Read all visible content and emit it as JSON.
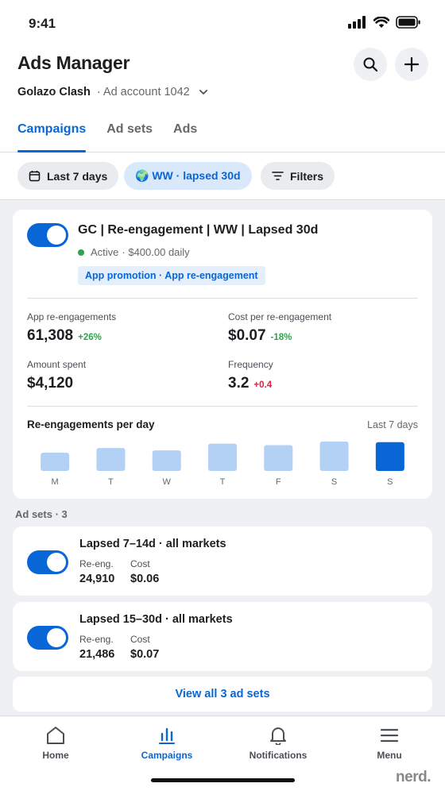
{
  "status_bar": {
    "time": "9:41"
  },
  "header": {
    "title": "Ads Manager",
    "account_name": "Golazo Clash",
    "account_id": "· Ad account 1042",
    "tabs": [
      {
        "label": "Campaigns",
        "active": true
      },
      {
        "label": "Ad sets",
        "active": false
      },
      {
        "label": "Ads",
        "active": false
      }
    ]
  },
  "filters": {
    "date": "Last 7 days",
    "audience": "🌍 WW · lapsed 30d",
    "filters": "Filters"
  },
  "campaign": {
    "name": "GC | Re-engagement | WW | Lapsed 30d",
    "status": "Active",
    "budget": "· $400.00 daily",
    "objective": "App promotion · App re-engagement",
    "metrics": [
      {
        "label": "App re-engagements",
        "value": "61,308",
        "delta": "+26%",
        "delta_color": "green"
      },
      {
        "label": "Cost per re-engagement",
        "value": "$0.07",
        "delta": "-18%",
        "delta_color": "green"
      },
      {
        "label": "Amount spent",
        "value": "$4,120",
        "delta": "",
        "delta_color": ""
      },
      {
        "label": "Frequency",
        "value": "3.2",
        "delta": "+0.4",
        "delta_color": "red"
      }
    ],
    "chart_title": "Re-engagements per day",
    "chart_range": "Last 7 days"
  },
  "chart_data": {
    "type": "bar",
    "title": "Re-engagements per day",
    "categories": [
      "M",
      "T",
      "W",
      "T",
      "F",
      "S",
      "S"
    ],
    "values": [
      0.62,
      0.78,
      0.7,
      0.93,
      0.88,
      1.0,
      0.98
    ],
    "highlight_index": 6,
    "colors": {
      "bar": "#b3d0f5",
      "highlight": "#0866d6"
    }
  },
  "adsets": {
    "section_label": "Ad sets · 3",
    "items": [
      {
        "name": "Lapsed 7–14d · all markets",
        "reeng_label": "Re-eng.",
        "reeng_value": "24,910",
        "cost_label": "Cost",
        "cost_value": "$0.06"
      },
      {
        "name": "Lapsed 15–30d · all markets",
        "reeng_label": "Re-eng.",
        "reeng_value": "21,486",
        "cost_label": "Cost",
        "cost_value": "$0.07"
      }
    ],
    "view_all": "View all 3 ad sets"
  },
  "nav": {
    "items": [
      {
        "label": "Home",
        "icon": "home-icon"
      },
      {
        "label": "Campaigns",
        "icon": "bar-chart-icon"
      },
      {
        "label": "Notifications",
        "icon": "bell-icon"
      },
      {
        "label": "Menu",
        "icon": "hamburger-icon"
      }
    ],
    "watermark": "nerd."
  },
  "colors": {
    "accent": "#0866d6",
    "positive": "#31a24c",
    "negative": "#e41e3f"
  }
}
